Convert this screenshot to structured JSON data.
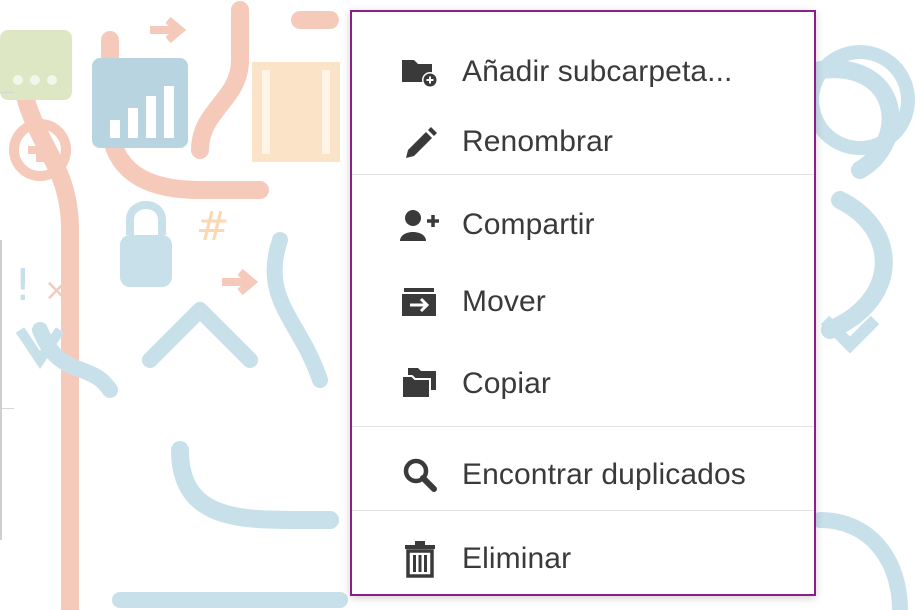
{
  "context_menu": {
    "accent_color": "#8b1f87",
    "items": [
      {
        "label": "Añadir subcarpeta...",
        "icon": "folder-add-icon"
      },
      {
        "label": "Renombrar",
        "icon": "pencil-icon"
      },
      {
        "label": "Compartir",
        "icon": "user-add-icon"
      },
      {
        "label": "Mover",
        "icon": "folder-move-icon"
      },
      {
        "label": "Copiar",
        "icon": "folder-copy-icon"
      },
      {
        "label": "Encontrar duplicados",
        "icon": "search-icon"
      },
      {
        "label": "Eliminar",
        "icon": "trash-icon"
      }
    ]
  }
}
